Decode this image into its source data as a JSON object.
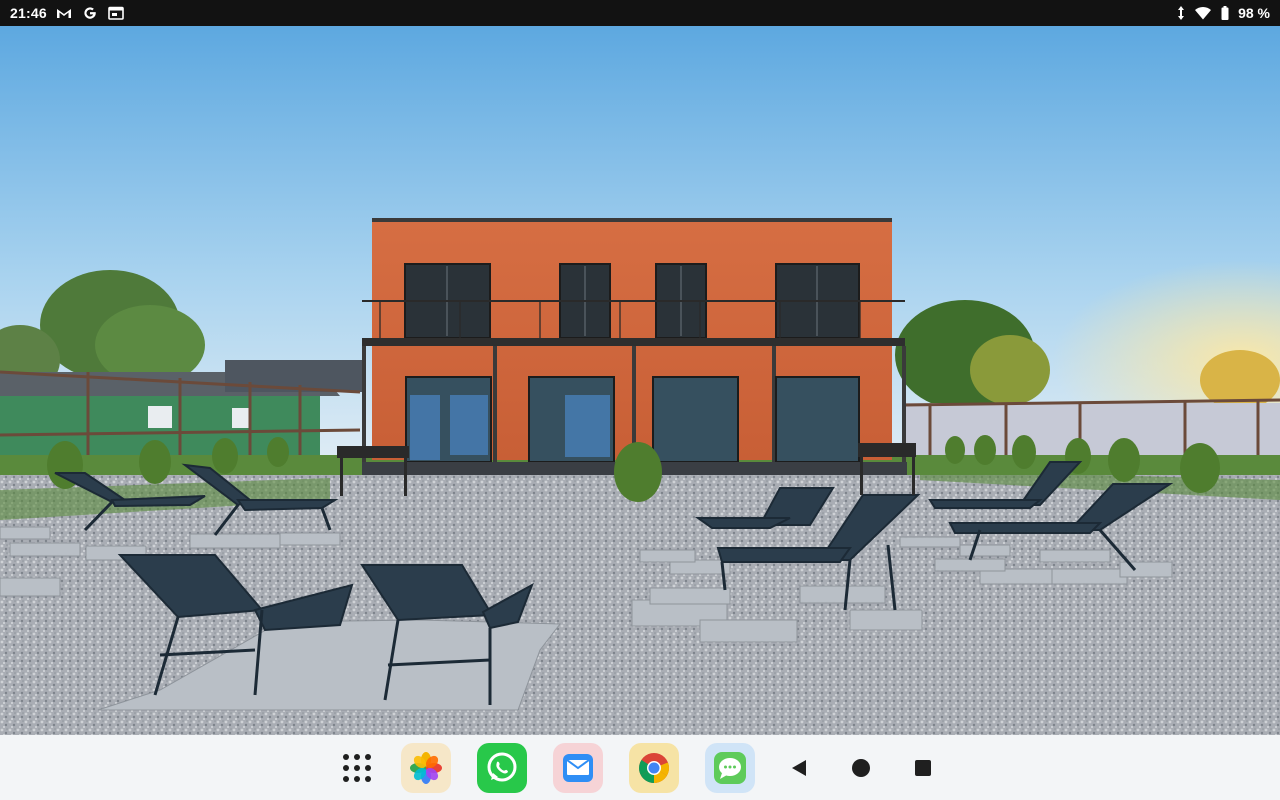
{
  "status_bar": {
    "time": "21:46",
    "notification_icons": [
      "gmail-icon",
      "google-icon",
      "calendar-icon"
    ],
    "system_icons": [
      "data-arrows-icon",
      "wifi-icon",
      "battery-icon"
    ],
    "battery_percent_text": "98 %",
    "battery_level": 0.98
  },
  "wallpaper": {
    "subject": "photo",
    "sky_top": "#5da8e0",
    "sky_bottom": "#e6eff5",
    "brick": "#d06a3f"
  },
  "navbar": {
    "apps": [
      {
        "name": "photos",
        "icon": "photos-icon",
        "bg": "#f6e7c8"
      },
      {
        "name": "whatsapp",
        "icon": "whatsapp-icon",
        "bg": "#28c84a"
      },
      {
        "name": "mail",
        "icon": "mail-icon",
        "bg": "#f6d3d6"
      },
      {
        "name": "chrome",
        "icon": "chrome-icon",
        "bg": "#f6e3a5"
      },
      {
        "name": "messages",
        "icon": "messages-icon",
        "bg": "#d0e4f7"
      }
    ],
    "system_buttons": [
      "back",
      "home",
      "recents"
    ]
  },
  "colors": {
    "status_bar_bg": "#121212",
    "navbar_bg": "#f3f5f7"
  }
}
